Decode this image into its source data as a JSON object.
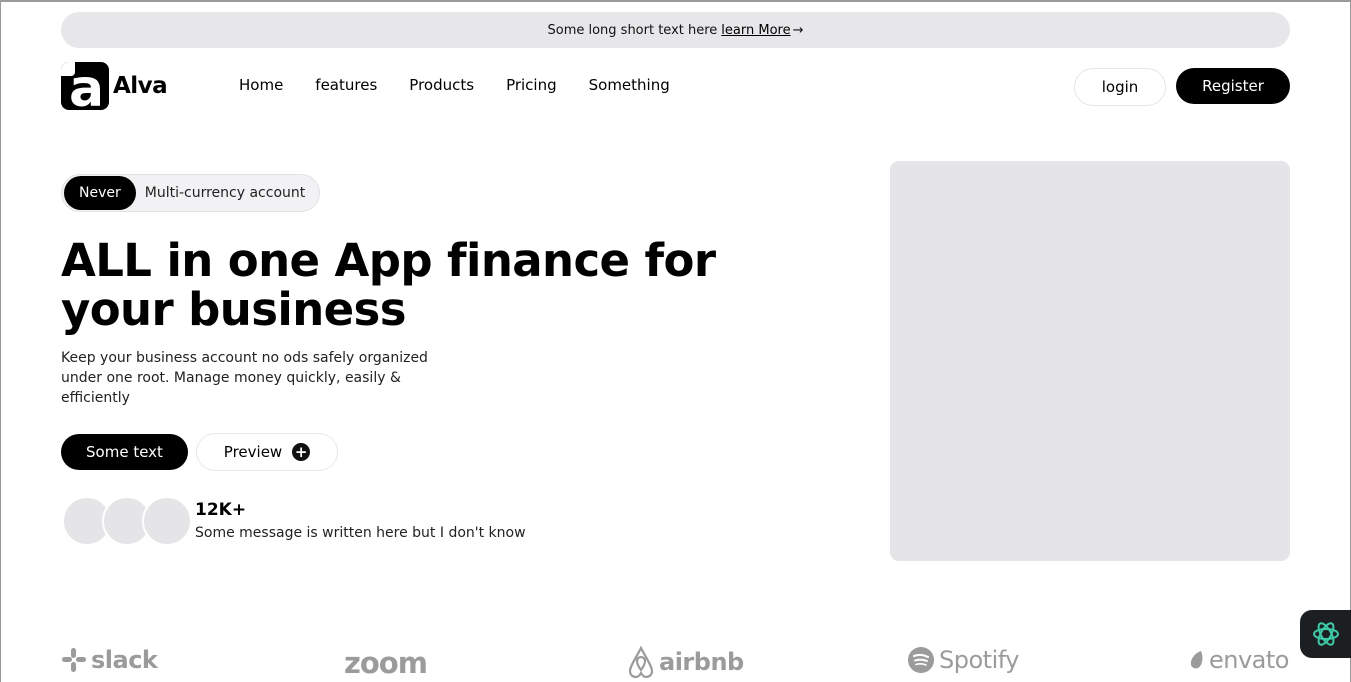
{
  "announcement": {
    "text": "Some long short text here",
    "link_label": "learn More",
    "arrow_icon": "→"
  },
  "nav": {
    "logo_letter": "a",
    "brand": "Alva",
    "menu": [
      "Home",
      "features",
      "Products",
      "Pricing",
      "Something"
    ],
    "login_label": "login",
    "register_label": "Register"
  },
  "hero": {
    "pill_tag": "Never",
    "pill_text": "Multi-currency account",
    "headline": "ALL in one App finance for your business",
    "description": "Keep your business account no ods safely organized under one root. Manage money quickly, easily & efficiently",
    "primary_button": "Some text",
    "preview_button": "Preview",
    "preview_icon": "+",
    "stat_value": "12K+",
    "stat_message": "Some message is written here but I don't know"
  },
  "logos": {
    "items": [
      "slack",
      "zoom",
      "airbnb",
      "Spotify",
      "envato"
    ],
    "color": "#9b9b9b"
  },
  "colors": {
    "accent": "#000000",
    "announcement_bg": "#e7e7ea",
    "placeholder_bg": "#e5e5e8",
    "chat_icon": "#3ec9a7"
  }
}
